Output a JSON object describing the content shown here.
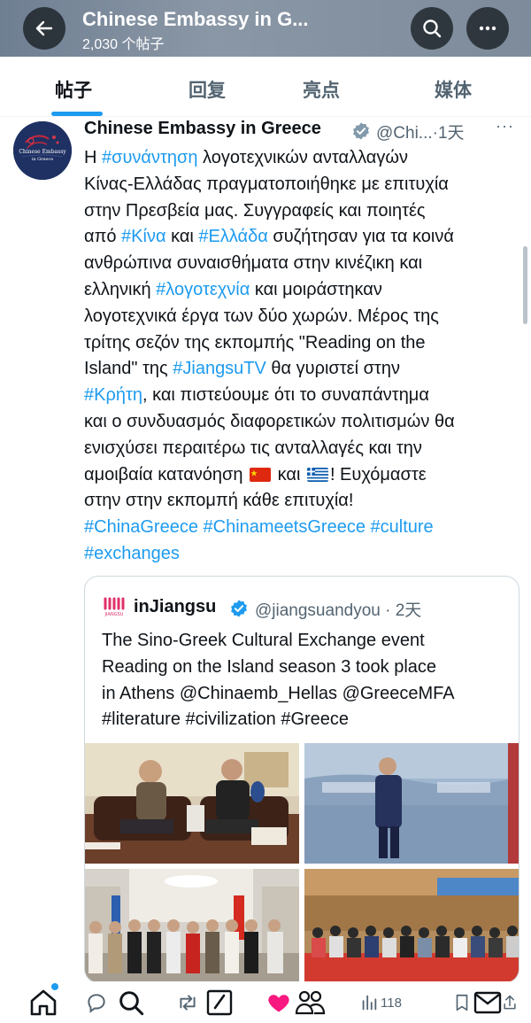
{
  "header": {
    "title": "Chinese Embassy in G...",
    "subtitle": "2,030 个帖子",
    "back_icon": "arrow-left-icon",
    "search_icon": "search-icon",
    "more_icon": "more-dots-icon"
  },
  "tabs": [
    {
      "label": "帖子",
      "active": true
    },
    {
      "label": "回复",
      "active": false
    },
    {
      "label": "亮点",
      "active": false
    },
    {
      "label": "媒体",
      "active": false
    }
  ],
  "tweet": {
    "author_name": "Chinese Embassy in Greece",
    "handle": "@Chi...",
    "time": "·1天",
    "more": "···",
    "avatar_text_1": "Chinese Embassy",
    "avatar_text_2": "in Greece",
    "lines": {
      "l1a": "Η ",
      "l1tag": "#συνάντηση",
      "l1b": " λογοτεχνικών ανταλλαγών",
      "l2": "Κίνας-Ελλάδας πραγματοποιήθηκε με επιτυχία",
      "l3": "στην Πρεσβεία μας. Συγγραφείς και ποιητές",
      "l4a": "από ",
      "l4tag1": "#Κίνα",
      "l4b": " και ",
      "l4tag2": "#Ελλάδα",
      "l4c": " συζήτησαν για τα κοινά",
      "l5": "ανθρώπινα συναισθήματα στην κινέζικη και",
      "l6a": "ελληνική ",
      "l6tag": "#λογοτεχνία",
      "l6b": " και μοιράστηκαν",
      "l7": "λογοτεχνικά έργα των δύο χωρών. Μέρος της",
      "l8": "τρίτης σεζόν της εκπομπής \"Reading on the",
      "l9a": "Island\" της ",
      "l9tag": "#JiangsuTV",
      "l9b": " θα γυριστεί στην",
      "l10tag": "#Κρήτη",
      "l10b": ", και πιστεύουμε ότι το συναπάντημα",
      "l11": "και ο συνδυασμός διαφορετικών πολιτισμών θα",
      "l12": "ενισχύσει περαιτέρω τις ανταλλαγές και την",
      "l13a": "αμοιβαία κατανόηση ",
      "l13b": " και ",
      "l13c": "! Ευχόμαστε",
      "l14": "στην στην εκπομπή κάθε επιτυχία!",
      "l15": "#ChinaGreece #ChinameetsGreece #culture",
      "l16": "#exchanges"
    }
  },
  "quote": {
    "name": "inJiangsu",
    "handle": "@jiangsuandyou · 2天",
    "lines": [
      "The Sino-Greek Cultural Exchange event",
      "Reading on the Island season 3 took place",
      "in Athens @Chinaemb_Hellas @GreeceMFA",
      "#literature #civilization #Greece"
    ],
    "logo_caption": "JIANGSU",
    "photos": [
      "photo-writers-conversation",
      "photo-speaker-stage",
      "photo-group-portrait",
      "photo-audience-hall"
    ]
  },
  "bottom_nav": {
    "home_icon": "home-icon",
    "reply_icon": "reply-icon",
    "search_icon": "search-icon",
    "retweet_icon": "retweet-icon",
    "compose_icon": "compose-icon",
    "like_icon": "heart-icon",
    "communities_icon": "people-icon",
    "views_icon": "views-icon",
    "views_count": "118",
    "bookmark_icon": "bookmark-icon",
    "messages_icon": "mail-icon",
    "share_icon": "share-icon"
  },
  "colors": {
    "accent": "#1d9bf0",
    "text": "#0f1419",
    "muted": "#536471",
    "like": "#f91880"
  }
}
